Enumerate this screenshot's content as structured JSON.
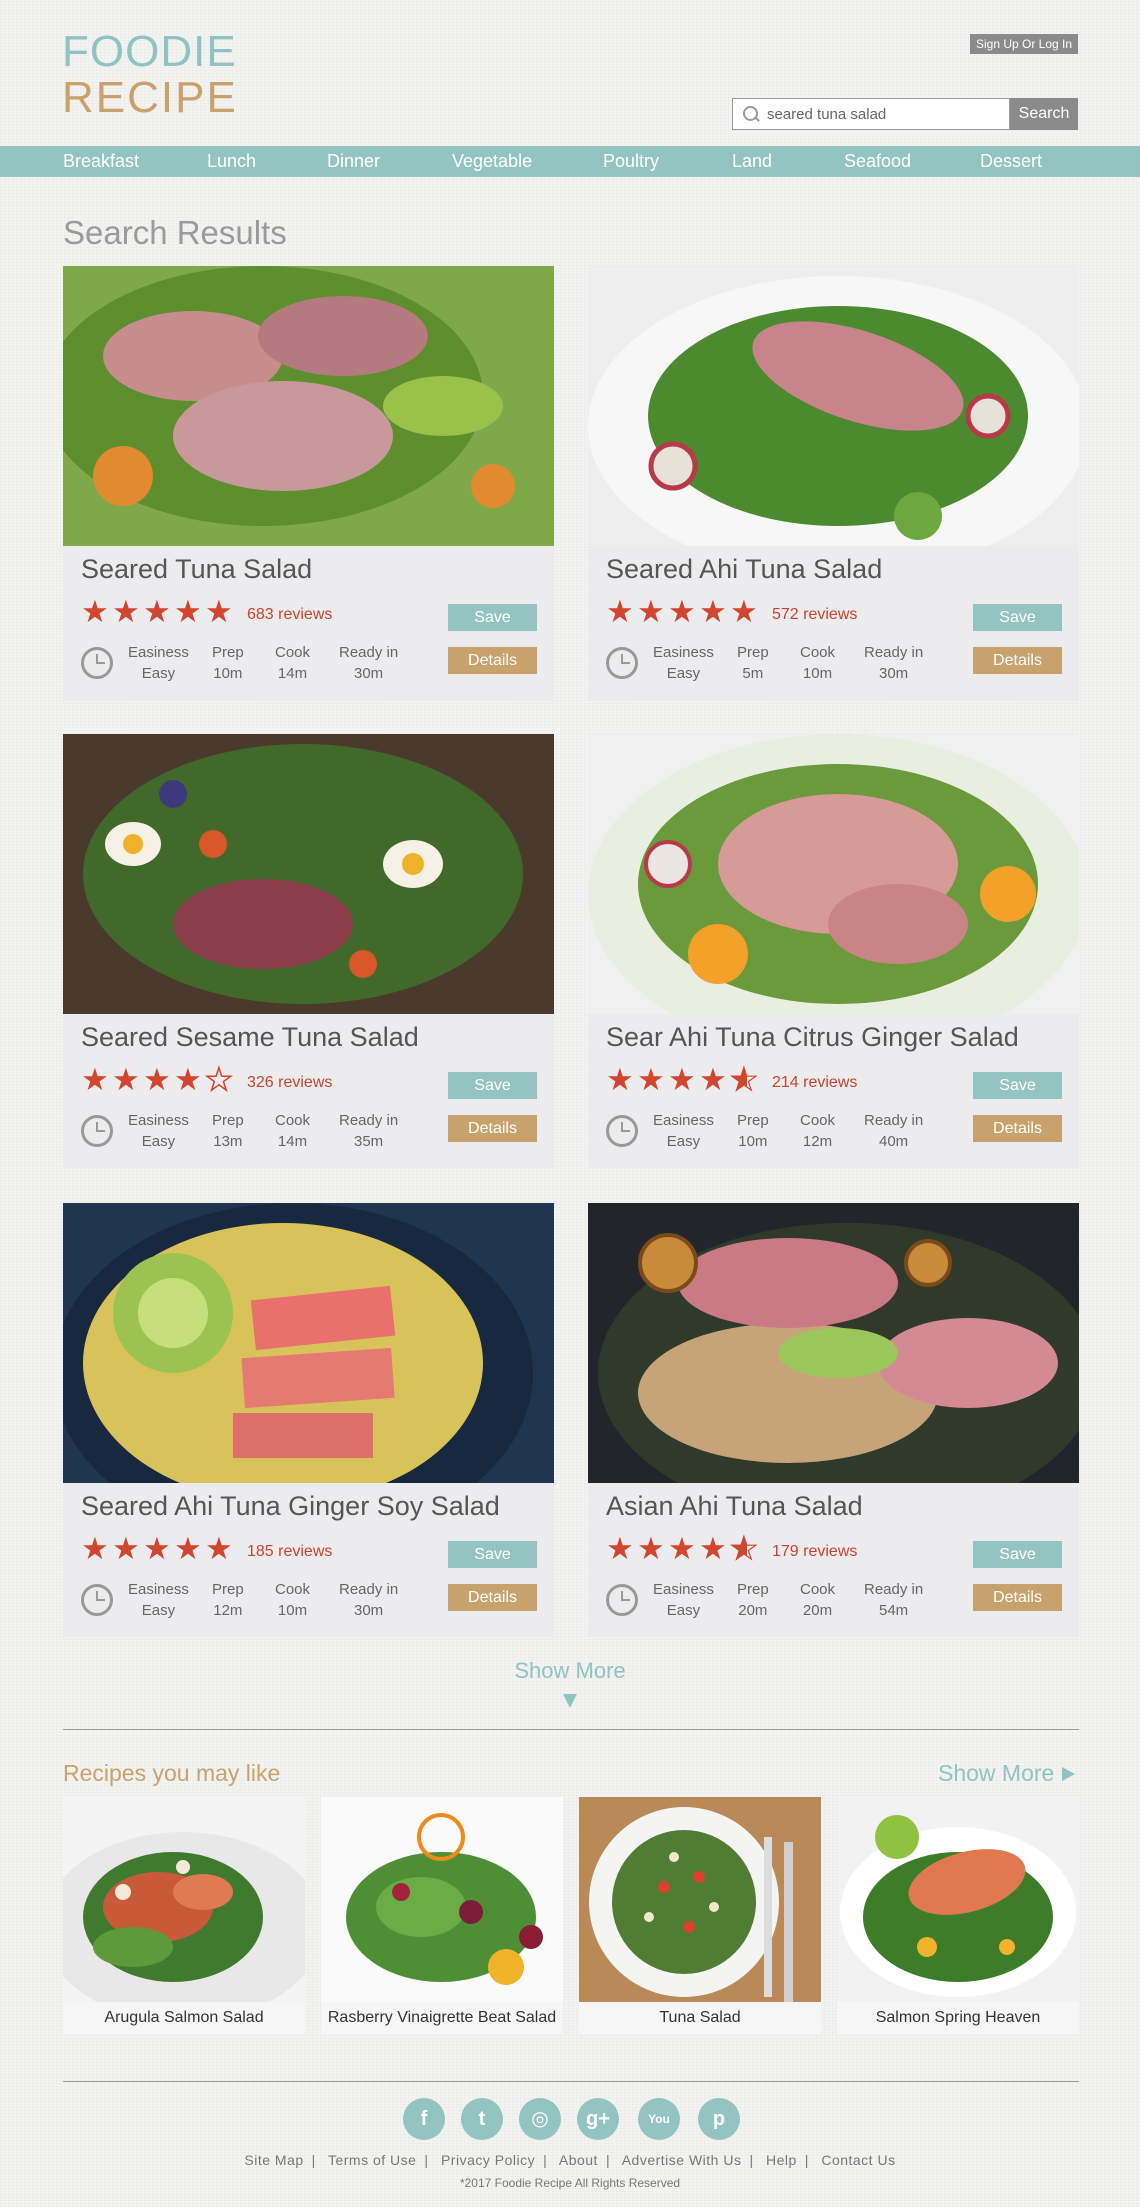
{
  "header": {
    "logo_line1": "FOODIE",
    "logo_line2": "RECIPE",
    "auth_label": "Sign Up Or Log In",
    "search_value": "seared tuna salad",
    "search_button": "Search"
  },
  "nav": [
    "Breakfast",
    "Lunch",
    "Dinner",
    "Vegetable",
    "Poultry",
    "Land",
    "Seafood",
    "Dessert"
  ],
  "results": {
    "title": "Search Results",
    "meta_labels": {
      "easiness": "Easiness",
      "prep": "Prep",
      "cook": "Cook",
      "ready": "Ready in"
    },
    "save_label": "Save",
    "details_label": "Details",
    "cards": [
      {
        "title": "Seared Tuna Salad",
        "rating": 5,
        "reviews": "683 reviews",
        "easiness": "Easy",
        "prep": "10m",
        "cook": "14m",
        "ready": "30m"
      },
      {
        "title": "Seared Ahi Tuna Salad",
        "rating": 5,
        "reviews": "572 reviews",
        "easiness": "Easy",
        "prep": "5m",
        "cook": "10m",
        "ready": "30m"
      },
      {
        "title": "Seared Sesame Tuna Salad",
        "rating": 4,
        "reviews": "326 reviews",
        "easiness": "Easy",
        "prep": "13m",
        "cook": "14m",
        "ready": "35m"
      },
      {
        "title": "Sear Ahi Tuna Citrus Ginger Salad",
        "rating": 4.5,
        "reviews": "214 reviews",
        "easiness": "Easy",
        "prep": "10m",
        "cook": "12m",
        "ready": "40m"
      },
      {
        "title": "Seared Ahi Tuna Ginger Soy Salad",
        "rating": 5,
        "reviews": "185 reviews",
        "easiness": "Easy",
        "prep": "12m",
        "cook": "10m",
        "ready": "30m"
      },
      {
        "title": "Asian Ahi Tuna Salad",
        "rating": 4.5,
        "reviews": "179 reviews",
        "easiness": "Easy",
        "prep": "20m",
        "cook": "20m",
        "ready": "54m"
      }
    ],
    "show_more": "Show More"
  },
  "suggestions": {
    "title": "Recipes you may like",
    "show_more": "Show More",
    "items": [
      "Arugula Salmon Salad",
      "Rasberry Vinaigrette Beat Salad",
      "Tuna Salad",
      "Salmon Spring Heaven"
    ]
  },
  "footer": {
    "social": [
      "facebook-icon",
      "twitter-icon",
      "instagram-icon",
      "google-plus-icon",
      "youtube-icon",
      "pinterest-icon"
    ],
    "social_glyphs": [
      "f",
      "t",
      "◎",
      "g+",
      "You",
      "p"
    ],
    "links": [
      "Site Map",
      "Terms of Use",
      "Privacy Policy",
      "About",
      "Advertise With Us",
      "Help",
      "Contact Us"
    ],
    "copyright": "*2017 Foodie Recipe All Rights Reserved"
  },
  "colors": {
    "teal": "#93c4c2",
    "gold": "#c7a26c",
    "star_red": "#d2452f"
  }
}
